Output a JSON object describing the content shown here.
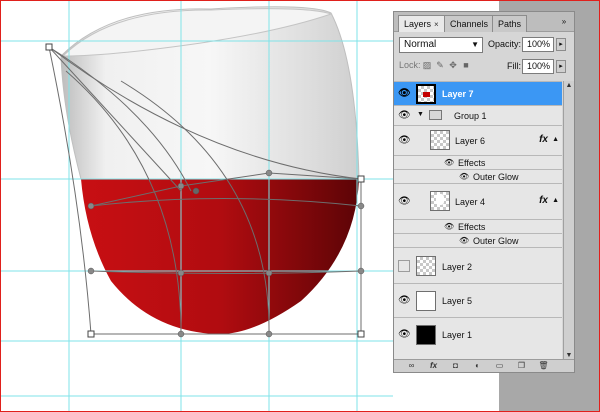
{
  "panel": {
    "tabs": [
      {
        "label": "Layers",
        "close": "×"
      },
      {
        "label": "Channels"
      },
      {
        "label": "Paths"
      }
    ],
    "menu_icon": "»",
    "blend_mode": "Normal",
    "opacity_label": "Opacity:",
    "opacity_value": "100%",
    "lock_label": "Lock:",
    "fill_label": "Fill:",
    "fill_value": "100%",
    "layers": [
      {
        "name": "Layer 7",
        "selected": true,
        "visible": true,
        "thumb": "checker-red"
      },
      {
        "name": "Group 1",
        "type": "group",
        "visible": true
      },
      {
        "name": "Layer 6",
        "visible": true,
        "thumb": "checker",
        "fx": "fx"
      },
      {
        "name": "Effects",
        "type": "effects"
      },
      {
        "name": "Outer Glow",
        "type": "effect"
      },
      {
        "name": "Layer 4",
        "visible": true,
        "thumb": "checker-white",
        "fx": "fx"
      },
      {
        "name": "Effects",
        "type": "effects"
      },
      {
        "name": "Outer Glow",
        "type": "effect"
      },
      {
        "name": "Layer 2",
        "visible": false,
        "thumb": "checker"
      },
      {
        "name": "Layer 5",
        "visible": true,
        "thumb": "white"
      },
      {
        "name": "Layer 1",
        "visible": true,
        "thumb": "black"
      }
    ],
    "bottom_icons": [
      "link-icon",
      "fx-icon",
      "mask-icon",
      "adjustment-icon",
      "folder-icon",
      "new-layer-icon",
      "trash-icon"
    ]
  },
  "colors": {
    "selection_blue": "#3b97f4",
    "guide_cyan": "#7fe3e8",
    "wine_red": "#b30d12"
  }
}
